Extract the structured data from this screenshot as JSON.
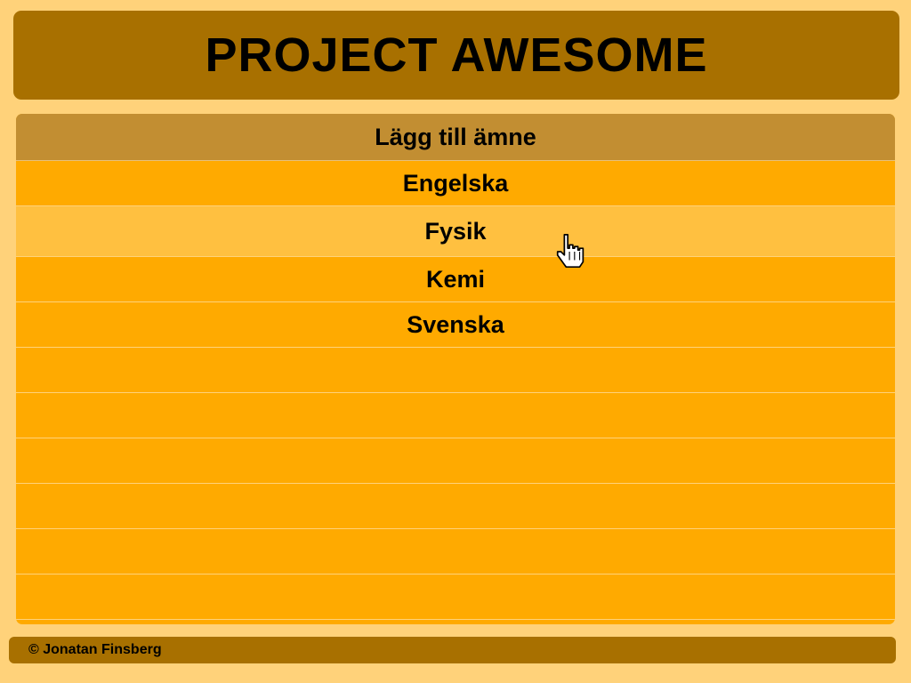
{
  "header": {
    "title": "PROJECT AWESOME"
  },
  "panel": {
    "header_label": "Lägg till ämne",
    "items": [
      {
        "label": "Engelska"
      },
      {
        "label": "Fysik"
      },
      {
        "label": "Kemi"
      },
      {
        "label": "Svenska"
      },
      {
        "label": ""
      },
      {
        "label": ""
      },
      {
        "label": ""
      },
      {
        "label": ""
      },
      {
        "label": ""
      },
      {
        "label": ""
      }
    ],
    "hovered_index": 1
  },
  "cursor": {
    "icon": "hand-pointer-icon"
  },
  "footer": {
    "copyright": "© Jonatan Finsberg"
  },
  "colors": {
    "background": "#FFD27A",
    "header_bg": "#A87000",
    "panel_bg": "#FFAA00",
    "panel_header_bg": "#C28E32",
    "hover_bg": "#FFC040",
    "text": "#000000"
  }
}
